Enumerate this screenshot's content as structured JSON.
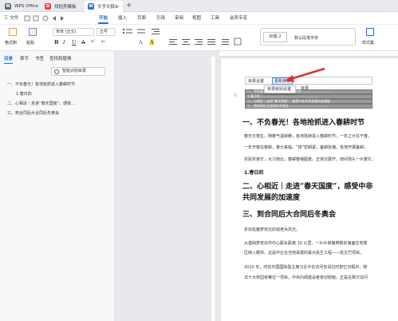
{
  "titlebar": {
    "tabs": [
      {
        "label": "WPS Office",
        "icon": "wps-logo-icon",
        "color": "#5f6b7a"
      },
      {
        "label": "找稻壳模板",
        "icon": "docer-icon",
        "color": "#e34a3b"
      },
      {
        "label": "文字文稿1",
        "icon": "writer-doc-icon",
        "color": "#2f6fe0"
      }
    ],
    "new_tab": "+"
  },
  "menubar": {
    "file": "三 文件",
    "items": [
      "开始",
      "插入",
      "页面",
      "引用",
      "审阅",
      "视图",
      "工具",
      "会员专享"
    ],
    "active": "开始"
  },
  "ribbon": {
    "format_painter": "格式刷",
    "paste": "粘贴",
    "font_name": "宋体 (正文)",
    "font_size": "五号",
    "format_buttons": [
      "B",
      "I",
      "U",
      "A",
      "x²",
      "x₂",
      "A",
      "A"
    ],
    "style_preview": "标题 2",
    "style_default": "默认段落字体",
    "style_set": "样式集"
  },
  "nav": {
    "tabs": [
      "目录",
      "章节",
      "书签",
      "查找和替换"
    ],
    "active_tab": "目录",
    "smart_button": "智能识别目录",
    "toc": [
      "一、不负春光！各地抢抓进入春耕时节",
      "1.春日的",
      "二、心相近｜走进“春天国度”，感受...",
      "三、到合同后大合同后冬奥会"
    ]
  },
  "table_toolbar": {
    "items": [
      "目录设置",
      "更新目录"
    ],
    "popup": "目录级别设置",
    "header": "目录"
  },
  "table_rows": [
    "一、不负春光！各地抢抓进入春耕时节 ............................",
    "1.春日的 ..........................................................",
    "二、心相近｜走进“春天国度”，感受中非共同发展的加速度 ....",
    "三、到合同后大合同后冬奥会 ......................................"
  ],
  "document": {
    "heading1": "一、不负春光！各地抢抓进入春耕时节",
    "para1": [
      "春天万物生，随着气温转暖，各地陆续进入春耕时节，一年之计在于春，",
      "一年开春在春耕，春分来临，“排”密耕紧，备耕抢播，各地开展备耕，",
      "农民农家忙，大江南北，春耕春播图景，正渐次展开，田间地头一片繁忙。"
    ],
    "sub1": "1.春日的",
    "heading2_line1": "二、心相近｜走进“春天国度”，感受中非",
    "heading2_line2": "共同发展的加速度",
    "heading3": "三、到合同后大合同后冬奥会",
    "para2": "折扣佐藤梦安达的钱老兵风光。",
    "para3": [
      "从基础梦安出市中心距车距离 10 公里，一片片锦鬼带致的海面住宅楼",
      "区映入眼帘，这是中企在当地承建的最大民生工程——凯文巴项目。"
    ],
    "para4": [
      "2010 年，时任中国国际副主席习近平在访问安哥拉时复忆日程中，随",
      "法十大校园考察过一项目，中央内阁建设者亲切慰勉，正是在那次访问"
    ]
  }
}
